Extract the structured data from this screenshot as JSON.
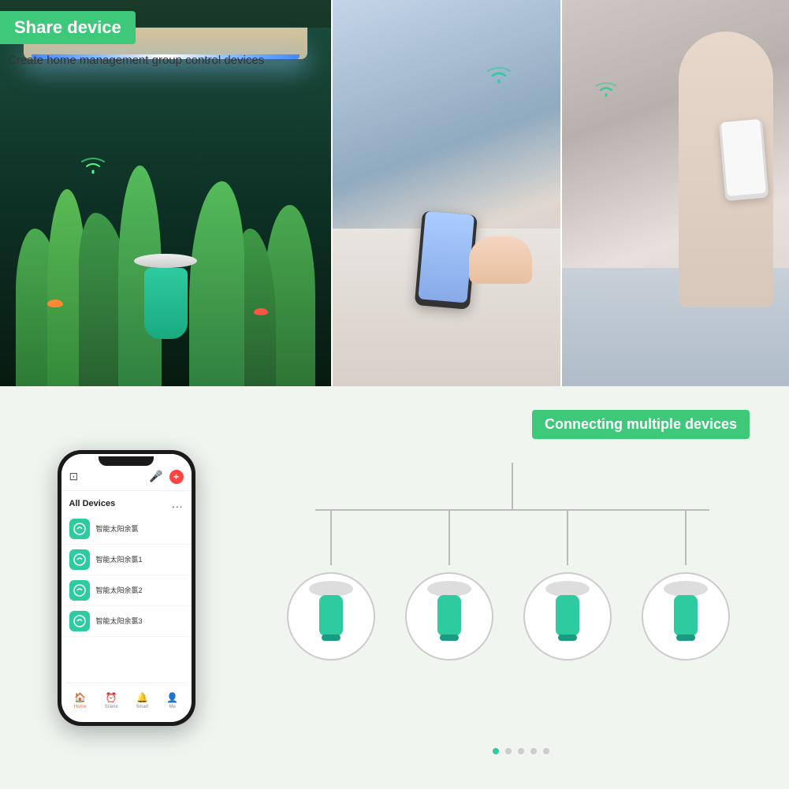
{
  "header": {
    "share_badge": "Share device",
    "subtitle": "Create home management group control devices"
  },
  "bottom_header": {
    "connecting_badge": "Connecting multiple devices"
  },
  "smartphone": {
    "all_devices_label": "All Devices",
    "dots_menu": "...",
    "devices": [
      {
        "name": "智能太阳余氯",
        "icon": "Y"
      },
      {
        "name": "智能太阳余氯1",
        "icon": "Y"
      },
      {
        "name": "智能太阳余氯2",
        "icon": "Y"
      },
      {
        "name": "智能太阳余氯3",
        "icon": "Y"
      }
    ],
    "nav_items": [
      {
        "label": "Home",
        "icon": "🏠",
        "active": true
      },
      {
        "label": "Scene",
        "icon": "⏰",
        "active": false
      },
      {
        "label": "Smart",
        "icon": "🔔",
        "active": false
      },
      {
        "label": "Me",
        "icon": "👤",
        "active": false
      }
    ]
  },
  "pagination": {
    "dots": [
      "active",
      "inactive",
      "inactive",
      "inactive",
      "inactive"
    ]
  },
  "colors": {
    "green_accent": "#3ec87a",
    "teal": "#2ecaa0",
    "bg_light": "#f0f5f0"
  }
}
